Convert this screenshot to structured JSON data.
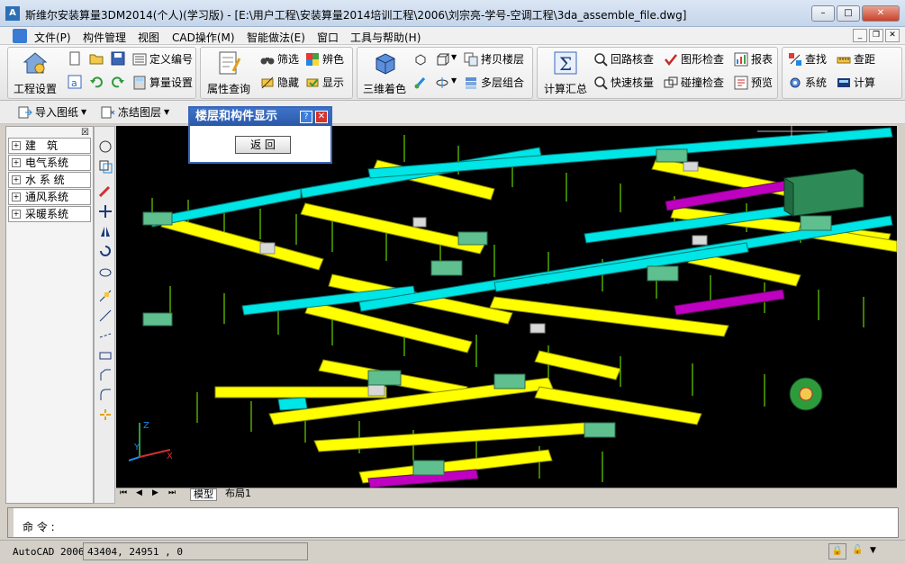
{
  "window": {
    "title": "斯维尔安装算量3DM2014(个人)(学习版) - [E:\\用户工程\\安装算量2014培训工程\\2006\\刘宗亮-学号-空调工程\\3da_assemble_file.dwg]",
    "app_icon": "A"
  },
  "menu": [
    "文件(P)",
    "构件管理",
    "视图",
    "CAD操作(M)",
    "智能做法(E)",
    "窗口",
    "工具与帮助(H)"
  ],
  "ribbon": {
    "project_settings": "工程设置",
    "define_number": "定义编号",
    "calc_settings": "算量设置",
    "attr_query": "属性查询",
    "filter": "筛选",
    "hide": "隐藏",
    "color_identify": "辨色",
    "show": "显示",
    "three_d_color": "三维着色",
    "copy_floor": "拷贝楼层",
    "multi_floor": "多层组合",
    "calc_summary": "计算汇总",
    "loop_check": "回路核查",
    "fast_check": "快速核量",
    "shape_check": "图形检查",
    "collision_check": "碰撞检查",
    "report": "报表",
    "preview": "预览",
    "find": "查找",
    "distance": "查距",
    "system": "系统",
    "calculate": "计算"
  },
  "toolbar2": {
    "import_drawing": "导入图纸",
    "freeze_layer": "冻结图层"
  },
  "left_panel": [
    "建　筑",
    "电气系统",
    "水 系 统",
    "通风系统",
    "采暖系统"
  ],
  "dialog": {
    "title": "楼层和构件显示",
    "return_button": "返 回"
  },
  "tabs": {
    "model": "模型",
    "layout": "布局1"
  },
  "command": {
    "prompt": "命 令 :"
  },
  "status": {
    "version": "AutoCAD 2006",
    "coords": "43404, 24951 , 0"
  },
  "colors": {
    "duct_yellow": "#ffff00",
    "duct_cyan": "#00e5e5",
    "duct_magenta": "#c000c0",
    "equip_green": "#2e8b57",
    "hanger_green": "#7cfc00"
  }
}
